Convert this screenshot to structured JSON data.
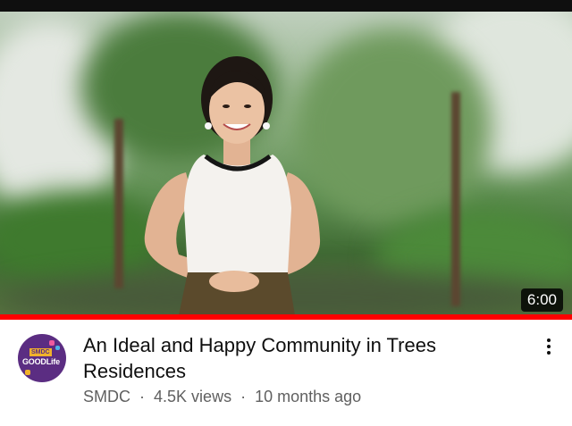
{
  "video": {
    "duration": "6:00",
    "progress": 1.0,
    "title": "An Ideal and Happy Community in Trees Residences",
    "channel": "SMDC",
    "views": "4.5K views",
    "age": "10 months ago",
    "separator": "·"
  },
  "channel_logo": {
    "badge_text": "SMDC",
    "wordmark": "GOODLife"
  },
  "icons": {
    "more": "more-vert-icon"
  },
  "colors": {
    "progress": "#ff0000",
    "title": "#0f0f0f",
    "meta": "#606060",
    "avatar_bg": "#5b2d82"
  }
}
